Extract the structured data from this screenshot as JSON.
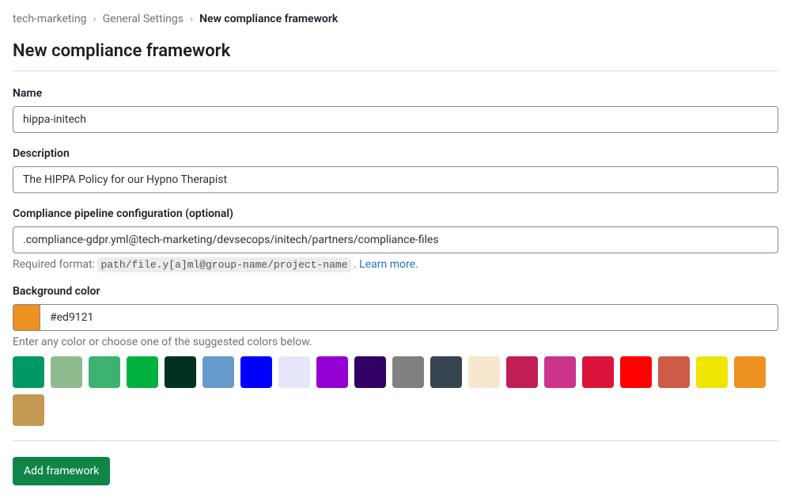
{
  "breadcrumb": {
    "items": [
      {
        "label": "tech-marketing"
      },
      {
        "label": "General Settings"
      },
      {
        "label": "New compliance framework"
      }
    ]
  },
  "page": {
    "title": "New compliance framework"
  },
  "form": {
    "name": {
      "label": "Name",
      "value": "hippa-initech"
    },
    "description": {
      "label": "Description",
      "value": "The HIPPA Policy for our Hypno Therapist"
    },
    "pipeline": {
      "label": "Compliance pipeline configuration (optional)",
      "value": ".compliance-gdpr.yml@tech-marketing/devsecops/initech/partners/compliance-files",
      "help_prefix": "Required format: ",
      "help_code": "path/file.y[a]ml@group-name/project-name",
      "help_suffix": " . ",
      "learn_more": "Learn more."
    },
    "color": {
      "label": "Background color",
      "value": "#ed9121",
      "help": "Enter any color or choose one of the suggested colors below.",
      "swatches": [
        "#009966",
        "#8fbc8f",
        "#3cb371",
        "#00b140",
        "#013220",
        "#6699cc",
        "#0000ff",
        "#e6e6fa",
        "#9400d3",
        "#330066",
        "#808080",
        "#36454f",
        "#f7e7ce",
        "#c21e56",
        "#cc338b",
        "#dc143c",
        "#ff0000",
        "#cd5b45",
        "#eee600",
        "#ed9121",
        "#c39953"
      ]
    },
    "submit": {
      "label": "Add framework"
    }
  }
}
